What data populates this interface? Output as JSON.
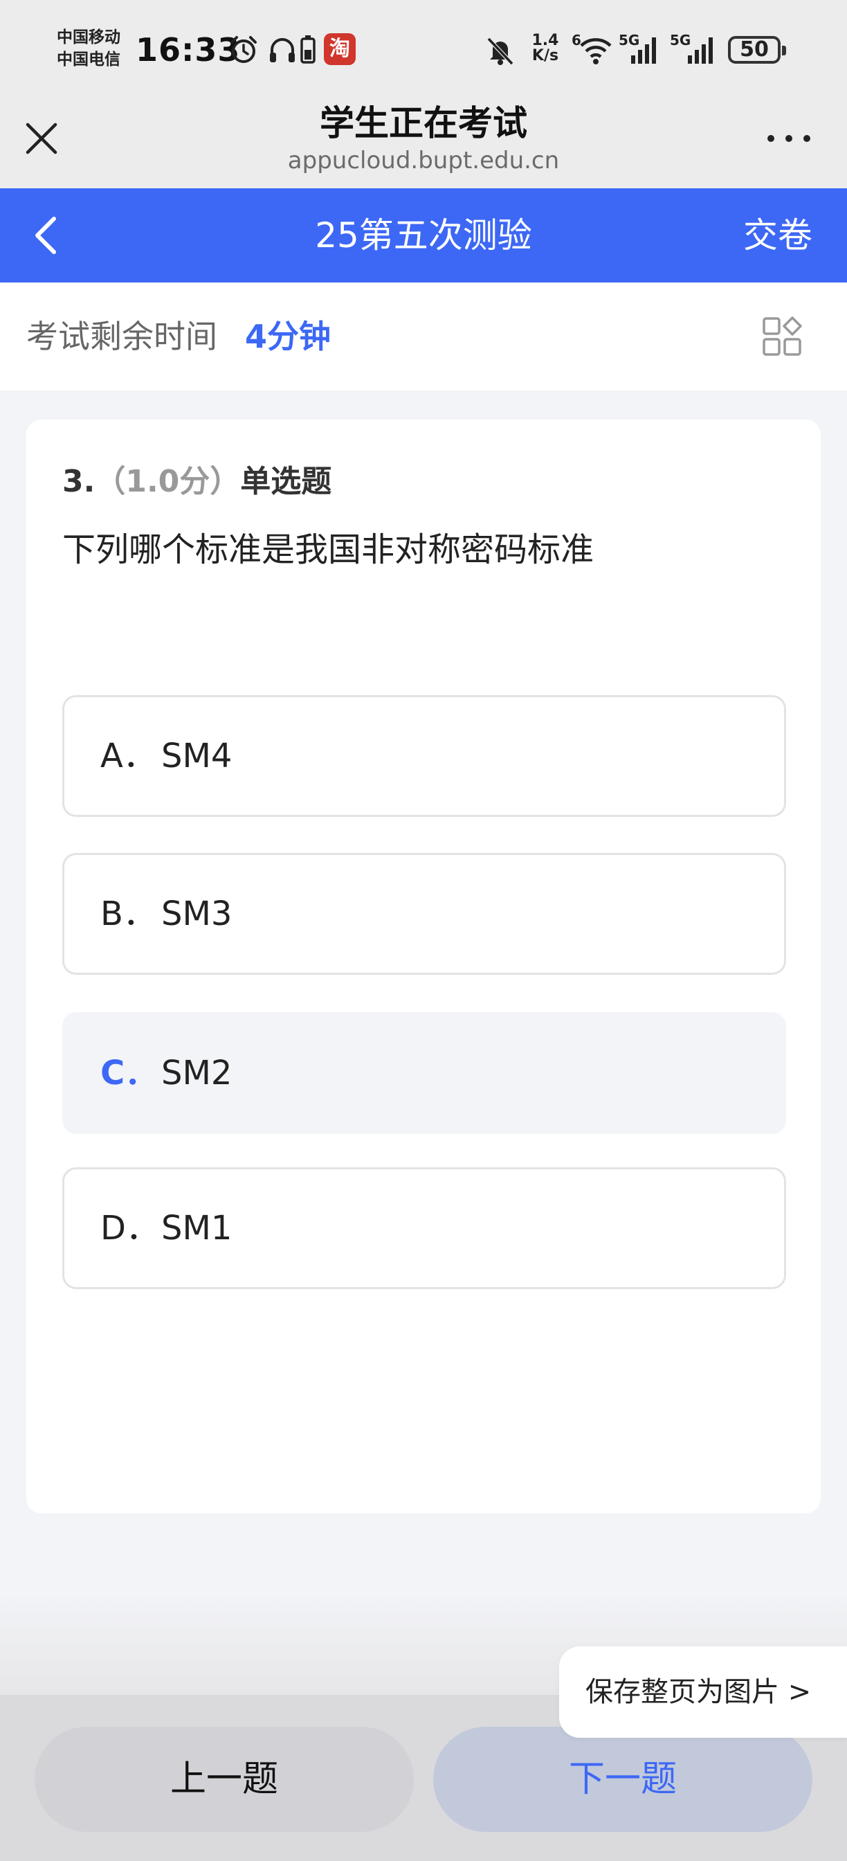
{
  "status_bar": {
    "carrier_1": "中国移动",
    "carrier_2": "中国电信",
    "time": "16:33",
    "icons": [
      "alarm-icon",
      "headphones-icon",
      "battery-small-icon",
      "taobao-app-icon",
      "bell-muted-icon",
      "wifi-icon",
      "cellular-signal-icon",
      "cellular-signal-icon"
    ],
    "taobao_glyph": "淘",
    "net_speed_value": "1.4",
    "net_speed_unit": "K/s",
    "wifi_label": "6",
    "sig1_label": "5G",
    "sig2_label": "5G",
    "battery_level": "50"
  },
  "browser": {
    "title": "学生正在考试",
    "url": "appucloud.bupt.edu.cn"
  },
  "nav": {
    "title": "25第五次测验",
    "submit_label": "交卷"
  },
  "timer": {
    "label": "考试剩余时间",
    "value": "4分钟"
  },
  "question": {
    "number": "3.",
    "score": "（1.0分）",
    "type": "单选题",
    "text": "下列哪个标准是我国非对称密码标准",
    "options": [
      {
        "letter": "A．",
        "text": "SM4",
        "selected": false
      },
      {
        "letter": "B．",
        "text": "SM3",
        "selected": false
      },
      {
        "letter": "C．",
        "text": "SM2",
        "selected": true
      },
      {
        "letter": "D．",
        "text": "SM1",
        "selected": false
      }
    ]
  },
  "footer": {
    "prev_label": "上一题",
    "next_label": "下一题",
    "save_image_label": "保存整页为图片 >"
  },
  "colors": {
    "accent": "#3d68f5",
    "page_bg": "#f3f4f7",
    "header_bg": "#ececec"
  }
}
